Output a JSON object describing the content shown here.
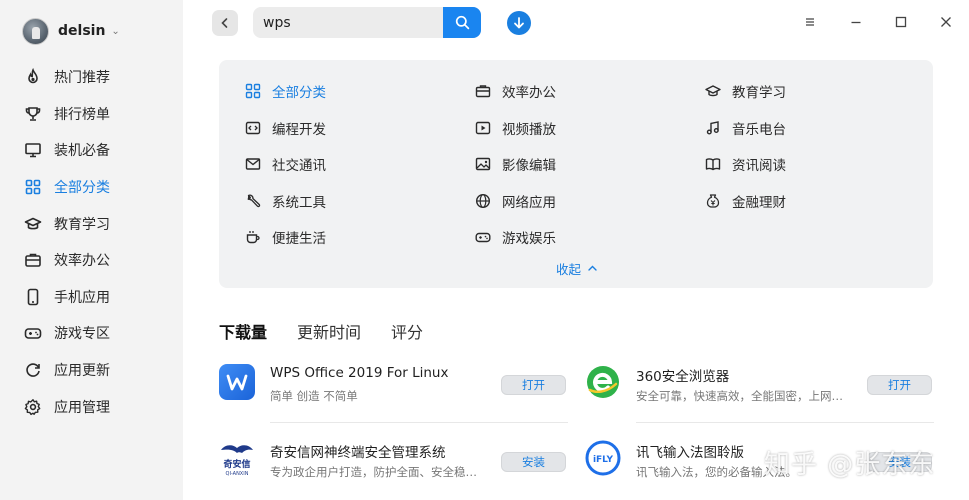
{
  "user": {
    "name": "delsin"
  },
  "sidebar": {
    "items": [
      {
        "label": "热门推荐"
      },
      {
        "label": "排行榜单"
      },
      {
        "label": "装机必备"
      },
      {
        "label": "全部分类"
      },
      {
        "label": "教育学习"
      },
      {
        "label": "效率办公"
      },
      {
        "label": "手机应用"
      },
      {
        "label": "游戏专区"
      },
      {
        "label": "应用更新"
      },
      {
        "label": "应用管理"
      }
    ],
    "active_color": "#1a7fe0"
  },
  "search": {
    "value": "wps",
    "button_color": "#1a85f0"
  },
  "categories": {
    "items": [
      {
        "label": "全部分类"
      },
      {
        "label": "效率办公"
      },
      {
        "label": "教育学习"
      },
      {
        "label": "编程开发"
      },
      {
        "label": "视频播放"
      },
      {
        "label": "音乐电台"
      },
      {
        "label": "社交通讯"
      },
      {
        "label": "影像编辑"
      },
      {
        "label": "资讯阅读"
      },
      {
        "label": "系统工具"
      },
      {
        "label": "网络应用"
      },
      {
        "label": "金融理财"
      },
      {
        "label": "便捷生活"
      },
      {
        "label": "游戏娱乐"
      }
    ],
    "collapse_label": "收起"
  },
  "sort": {
    "tabs": [
      {
        "label": "下载量"
      },
      {
        "label": "更新时间"
      },
      {
        "label": "评分"
      }
    ]
  },
  "apps": [
    {
      "name": "WPS Office 2019 For Linux",
      "desc": "简单 创造 不简单",
      "button": "打开"
    },
    {
      "name": "360安全浏览器",
      "desc": "安全可靠，快速高效，全能国密，上网…",
      "button": "打开"
    },
    {
      "name": "奇安信网神终端安全管理系统",
      "desc": "专为政企用户打造，防护全面、安全稳…",
      "button": "安装"
    },
    {
      "name": "讯飞输入法图聆版",
      "desc": "讯飞输入法，您的必备输入法。",
      "button": "安装"
    }
  ],
  "icons": {
    "wps": "wps-logo",
    "browser360": "360-browser-logo",
    "qianxin": "qianxin-logo",
    "ifly": "ifly-logo"
  },
  "watermark": "知乎 @张东东"
}
